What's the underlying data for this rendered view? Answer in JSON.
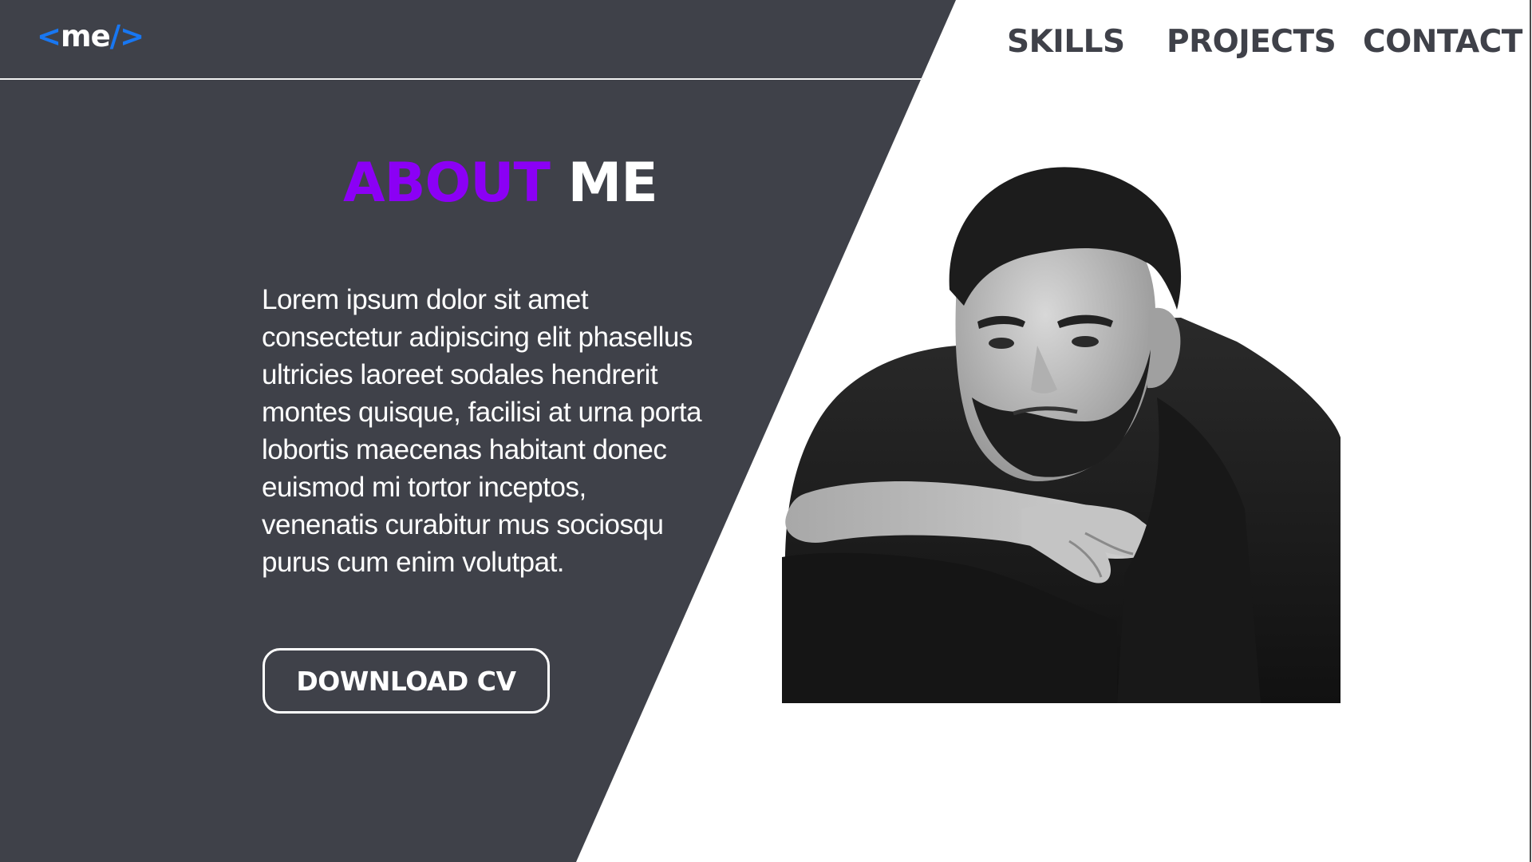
{
  "header": {
    "logo": {
      "open": "<",
      "text": "me",
      "close": "/>"
    },
    "nav": [
      {
        "label": "SKILLS"
      },
      {
        "label": "PROJECTS"
      },
      {
        "label": "CONTACT"
      }
    ]
  },
  "about": {
    "title_highlight": "ABOUT",
    "title_rest": "ME",
    "bio_lines": [
      "Lorem ipsum dolor sit amet",
      "consectetur adipiscing elit phasellus",
      "ultricies laoreet sodales hendrerit",
      "montes quisque, facilisi at urna porta",
      "lobortis maecenas habitant donec",
      "euismod mi tortor  inceptos,",
      "venenatis curabitur mus sociosqu",
      "purus cum enim volutpat."
    ],
    "cv_button": "DOWNLOAD CV"
  },
  "colors": {
    "dark_panel": "#3f4149",
    "accent_purple": "#8b00f5",
    "logo_blue": "#1877f2",
    "background": "#ffffff"
  },
  "icons": {
    "portrait": "portrait-photo"
  }
}
